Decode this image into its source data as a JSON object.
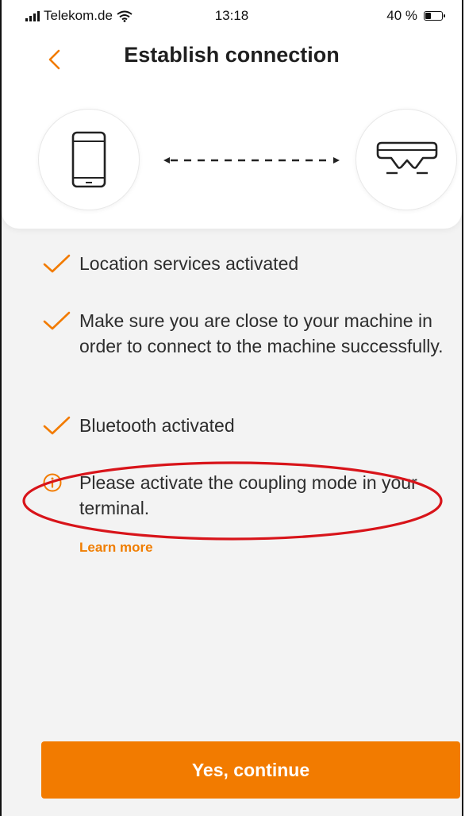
{
  "status_bar": {
    "carrier": "Telekom.de",
    "time": "13:18",
    "battery": "40 %",
    "battery_level": 0.4,
    "icons": [
      "signal-icon",
      "wifi-icon",
      "battery-icon"
    ]
  },
  "header": {
    "back_icon": "chevron-left-icon",
    "title": "Establish connection"
  },
  "connection": {
    "left_icon": "smartphone-icon",
    "right_icon": "glasses-icon",
    "link_icon": "dashed-double-arrow-icon"
  },
  "checklist": [
    {
      "status": "done",
      "icon": "checkmark-icon",
      "text": "Location services activated"
    },
    {
      "status": "done",
      "icon": "checkmark-icon",
      "text": "Make sure you are close to your machine in order to connect to the machine successfully."
    },
    {
      "status": "done",
      "icon": "checkmark-icon",
      "text": "Bluetooth activated"
    },
    {
      "status": "info",
      "icon": "info-circle-icon",
      "text": "Please activate the coupling mode in your terminal."
    }
  ],
  "learn_more": "Learn more",
  "primary_button": "Yes, continue",
  "colors": {
    "accent": "#f27b00",
    "background": "#f3f3f3",
    "annotation": "#d8141a"
  }
}
